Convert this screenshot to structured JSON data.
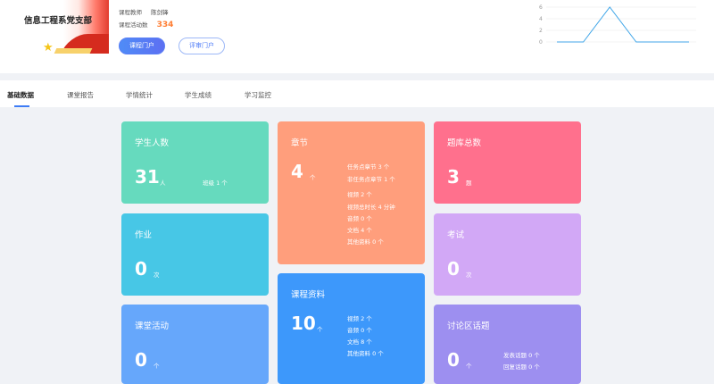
{
  "header": {
    "org_title": "信息工程系党支部",
    "teacher_label": "课程教师",
    "teacher_name": "陈剑锋",
    "activity_label": "课程活动数",
    "activity_count": "334",
    "course_portal_button": "课程门户",
    "review_portal_button": "评审门户"
  },
  "mini_chart": {
    "chart_data": {
      "type": "line",
      "x": [
        1,
        2,
        3,
        4,
        5,
        6
      ],
      "values": [
        0,
        0,
        6,
        0,
        0,
        0
      ],
      "ylim": [
        0,
        6
      ],
      "yticks": [
        "0",
        "2",
        "4",
        "6"
      ],
      "color": "#40a6e8"
    }
  },
  "tabs": [
    {
      "label": "基础数据",
      "active": true
    },
    {
      "label": "课堂报告",
      "active": false
    },
    {
      "label": "学情统计",
      "active": false
    },
    {
      "label": "学生成绩",
      "active": false
    },
    {
      "label": "学习监控",
      "active": false
    }
  ],
  "cards": {
    "students": {
      "title": "学生人数",
      "value": "31",
      "unit": "人",
      "extra": "班级 1 个"
    },
    "homework": {
      "title": "作业",
      "value": "0",
      "unit": "次"
    },
    "activity": {
      "title": "课堂活动",
      "value": "0",
      "unit": "个"
    },
    "chapters": {
      "title": "章节",
      "value": "4",
      "unit": "个",
      "details": [
        "任务点章节 3 个",
        "非任务点章节 1 个",
        "视频 2 个",
        "视频总时长 4 分钟",
        "音频 0 个",
        "文档 4 个",
        "其他资料 0 个"
      ]
    },
    "materials": {
      "title": "课程资料",
      "value": "10",
      "unit": "个",
      "details": [
        "视频 2 个",
        "音频 0 个",
        "文档 8 个",
        "其他资料 0 个"
      ]
    },
    "question_bank": {
      "title": "题库总数",
      "value": "3",
      "unit": "题"
    },
    "exam": {
      "title": "考试",
      "value": "0",
      "unit": "次"
    },
    "discussion": {
      "title": "讨论区话题",
      "value": "0",
      "unit": "个",
      "details": [
        "发表话题 0 个",
        "回复话题 0 个"
      ]
    }
  }
}
